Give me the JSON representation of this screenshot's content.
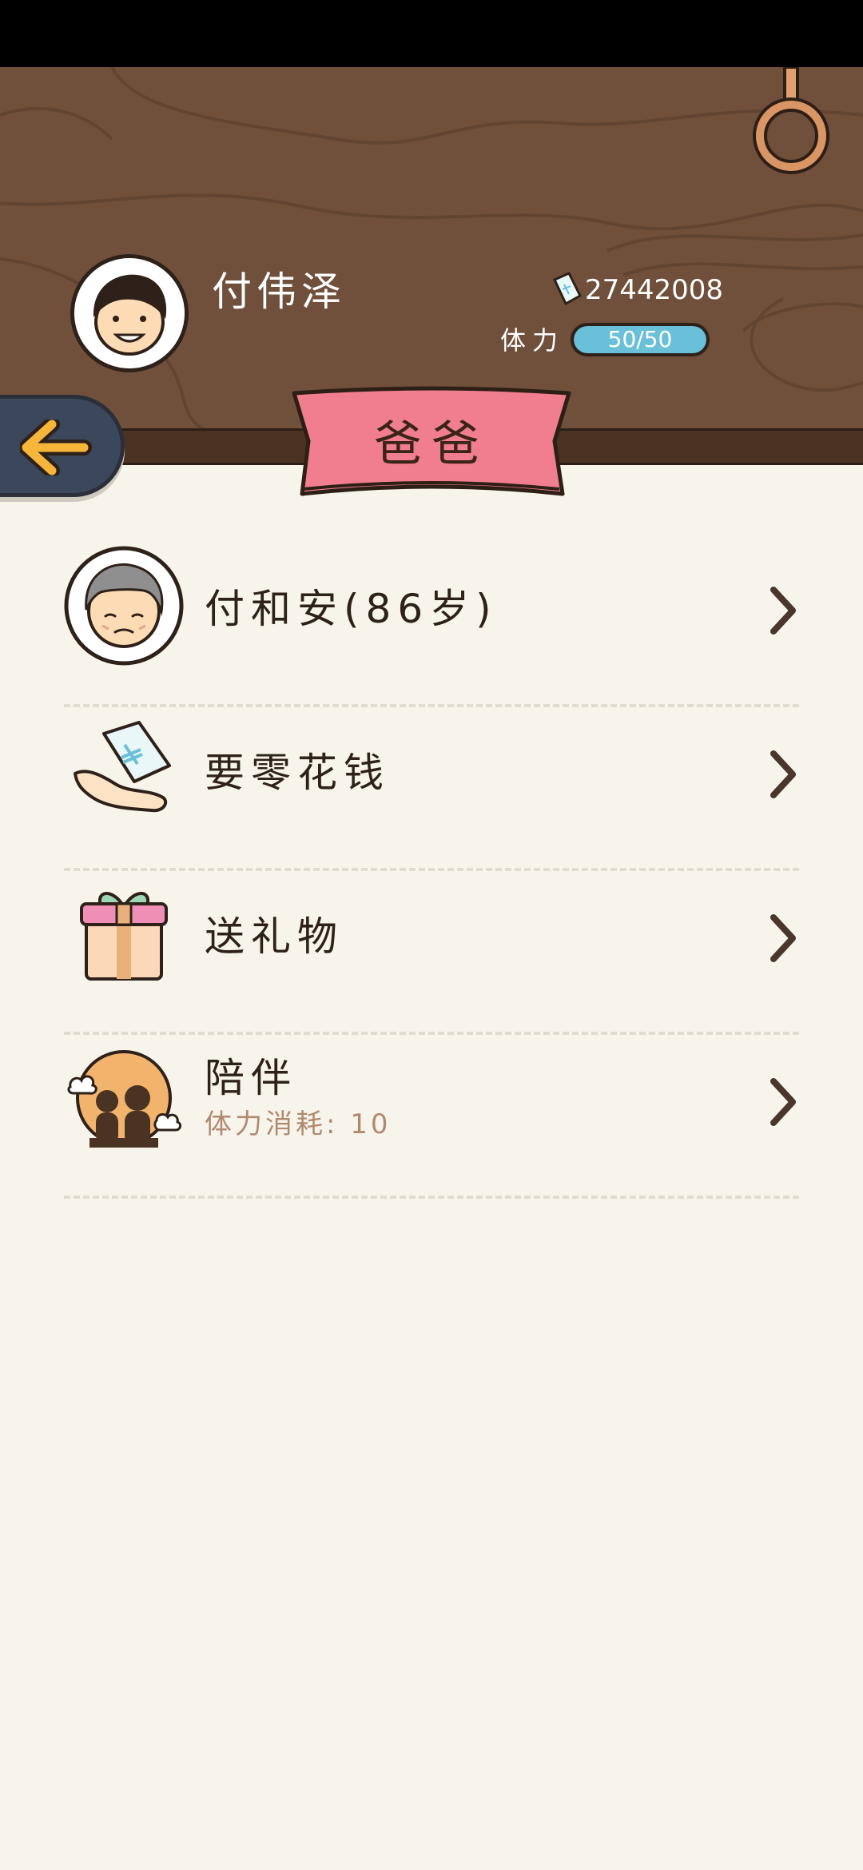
{
  "player": {
    "name": "付伟泽",
    "money": "27442008",
    "stamina_label": "体力",
    "stamina_text": "50/50",
    "stamina_current": 50,
    "stamina_max": 50
  },
  "page_title": "爸爸",
  "menu": [
    {
      "label": "付和安(86岁)",
      "icon": "grandpa-avatar-icon"
    },
    {
      "label": "要零花钱",
      "icon": "money-hand-icon"
    },
    {
      "label": "送礼物",
      "icon": "gift-icon"
    },
    {
      "label": "陪伴",
      "sub": "体力消耗: 10",
      "icon": "family-companion-icon"
    }
  ],
  "colors": {
    "wood": "#70503b",
    "banner": "#f07e8e",
    "back_button": "#3b475a",
    "back_arrow": "#f6b63a",
    "stamina_fill": "#6bc0d9",
    "background": "#f7f4ec"
  }
}
